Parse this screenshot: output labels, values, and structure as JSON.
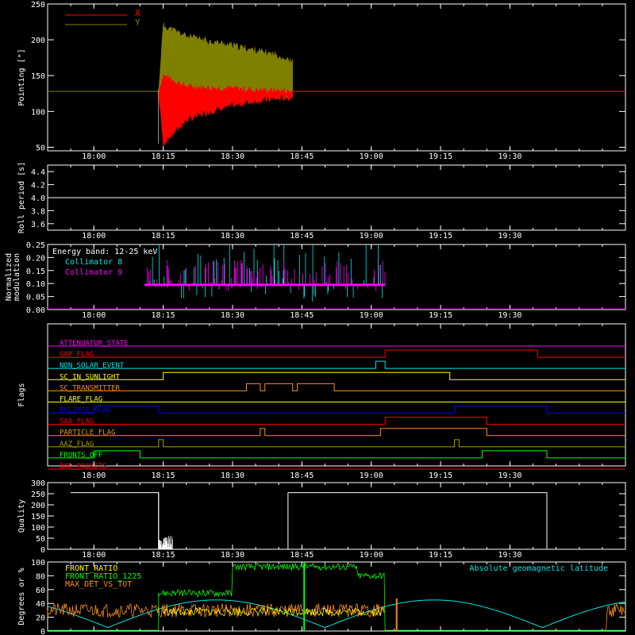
{
  "time_axis": {
    "start_min": 1070,
    "end_min": 1195,
    "ticks": [
      "18:00",
      "18:15",
      "18:30",
      "18:45",
      "19:00",
      "19:15",
      "19:30"
    ],
    "tick_mins": [
      1080,
      1095,
      1110,
      1125,
      1140,
      1155,
      1170
    ]
  },
  "colors": {
    "x": "#ff0000",
    "y": "#808000",
    "white": "#ffffff",
    "cyan": "#00e5e5",
    "magenta": "#ff00ff",
    "green": "#00ff00",
    "orange": "#ff8c1a",
    "yellow": "#ffff00",
    "blue": "#0000ff",
    "olive": "#a0a000"
  },
  "chart_data": [
    {
      "type": "area",
      "ylabel": "Pointing [\"]",
      "ylim": [
        45,
        250
      ],
      "yticks": [
        50,
        100,
        150,
        200,
        250
      ],
      "legend": [
        "X",
        "Y"
      ],
      "baseline": 128,
      "series": [
        {
          "name": "X",
          "x": [
            "18:14",
            "18:15",
            "18:20",
            "18:25",
            "18:30",
            "18:35",
            "18:40",
            "18:43"
          ],
          "upper": [
            128,
            150,
            135,
            133,
            132,
            130,
            129,
            128
          ],
          "lower": [
            128,
            55,
            88,
            100,
            108,
            115,
            118,
            120
          ]
        },
        {
          "name": "Y",
          "x": [
            "18:14",
            "18:15",
            "18:20",
            "18:25",
            "18:30",
            "18:35",
            "18:40",
            "18:43"
          ],
          "upper": [
            128,
            220,
            205,
            198,
            192,
            185,
            178,
            168
          ],
          "lower": [
            128,
            140,
            132,
            128,
            125,
            124,
            122,
            124
          ]
        }
      ]
    },
    {
      "type": "line",
      "ylabel": "Roll period [s]",
      "ylim": [
        3.5,
        4.5
      ],
      "yticks": [
        3.6,
        3.8,
        4.0,
        4.2,
        4.4
      ],
      "value": 4.0
    },
    {
      "type": "line",
      "ylabel": "Normalized modulation",
      "ylim": [
        0,
        0.25
      ],
      "yticks": [
        0.0,
        0.05,
        0.1,
        0.15,
        0.2,
        0.25
      ],
      "annotation": "Energy band: 12-25 keV",
      "legend": [
        "Collimator 8",
        "Collimator 9"
      ],
      "range": [
        "18:11",
        "19:03"
      ],
      "level": 0.095
    },
    {
      "type": "line",
      "ylabel": "Flags",
      "flags": [
        {
          "name": "ATTENUATOR_STATE",
          "color": "#ff00ff",
          "segments": []
        },
        {
          "name": "GAP_FLAG",
          "color": "#ff0000",
          "segments": [
            [
              "19:03",
              "19:36"
            ]
          ]
        },
        {
          "name": "NON_SOLAR_EVENT",
          "color": "#00e5e5",
          "segments": [
            [
              "19:01",
              "19:03"
            ]
          ]
        },
        {
          "name": "SC_IN_SUNLIGHT",
          "color": "#ffff00",
          "segments": [
            [
              "18:15",
              "19:17"
            ]
          ]
        },
        {
          "name": "SC_TRANSMITTER",
          "color": "#ff8c1a",
          "segments": [
            [
              "18:33",
              "18:36"
            ],
            [
              "18:37",
              "18:43"
            ],
            [
              "18:44",
              "18:52"
            ]
          ]
        },
        {
          "name": "FLARE_FLAG",
          "color": "#ffff00",
          "segments": []
        },
        {
          "name": "ECLIPSE_FLAG",
          "color": "#0000ff",
          "segments": [
            [
              "18:00",
              "18:14"
            ],
            [
              "19:18",
              "19:38"
            ]
          ]
        },
        {
          "name": "SAA_FLAG",
          "color": "#ff0000",
          "segments": [
            [
              "19:03",
              "19:25"
            ]
          ]
        },
        {
          "name": "PARTICLE_FLAG",
          "color": "#ff8c1a",
          "segments": [
            [
              "18:36",
              "18:37"
            ],
            [
              "19:02",
              "19:25"
            ]
          ]
        },
        {
          "name": "AAZ_FLAG",
          "color": "#a0a000",
          "segments": [
            [
              "18:14",
              "18:15"
            ],
            [
              "19:18",
              "19:19"
            ]
          ]
        },
        {
          "name": "FRONTS_OFF",
          "color": "#00ff00",
          "segments": [
            [
              "18:00",
              "18:10"
            ],
            [
              "19:24",
              "19:38"
            ]
          ]
        },
        {
          "name": "BAD_PACKETS",
          "color": "#ff0000",
          "segments": []
        }
      ]
    },
    {
      "type": "line",
      "ylabel": "Quality",
      "ylim": [
        0,
        300
      ],
      "yticks": [
        0,
        50,
        100,
        150,
        200,
        250,
        300
      ],
      "segments": [
        {
          "from": "17:55",
          "to": "18:14",
          "value": 255
        },
        {
          "from": "18:42",
          "to": "19:38",
          "value": 255
        }
      ]
    },
    {
      "type": "line",
      "ylabel": "Degrees or %",
      "ylim": [
        0,
        100
      ],
      "yticks": [
        0,
        20,
        40,
        60,
        80,
        100
      ],
      "legend": [
        "FRONT_RATIO",
        "FRONT_RATIO_1225",
        "MAX_DET_VS_TOT"
      ],
      "annotation": "Absolute geomagnetic latitude"
    }
  ]
}
